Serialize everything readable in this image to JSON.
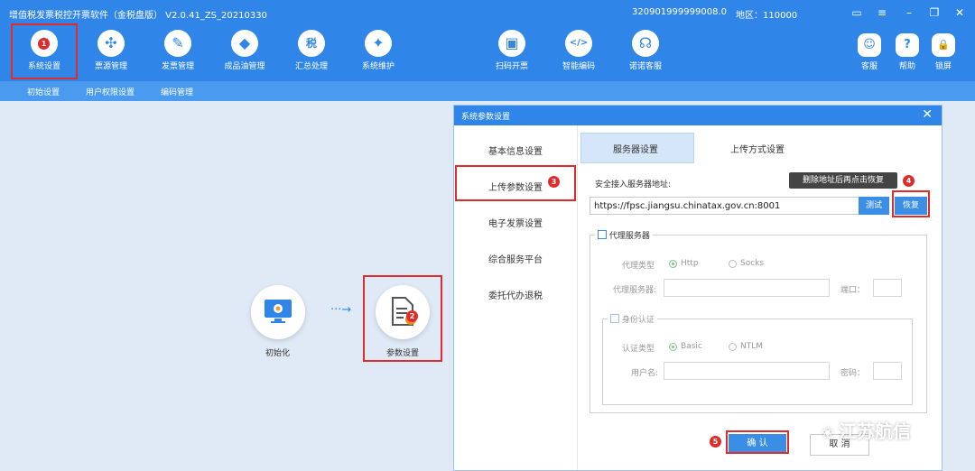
{
  "app": {
    "title": "增值税发票税控开票软件（金税盘版） V2.0.41_ZS_20210330",
    "tax_id": "320901999999008.0",
    "region": "地区：110000"
  },
  "toolbar": {
    "left": [
      {
        "label": "系统设置",
        "icon": "gear-icon",
        "glyph": "⚙"
      },
      {
        "label": "票源管理",
        "icon": "network-icon",
        "glyph": "✣"
      },
      {
        "label": "发票管理",
        "icon": "invoice-icon",
        "glyph": "✎"
      },
      {
        "label": "成品油管理",
        "icon": "oil-drum-icon",
        "glyph": "◆"
      },
      {
        "label": "汇总处理",
        "icon": "tax-summary-icon",
        "glyph": "税"
      },
      {
        "label": "系统维护",
        "icon": "wrench-icon",
        "glyph": "✦"
      }
    ],
    "middle": [
      {
        "label": "扫码开票",
        "icon": "scan-icon",
        "glyph": "▣"
      },
      {
        "label": "智能编码",
        "icon": "code-doc-icon",
        "glyph": "</>"
      },
      {
        "label": "诺诺客服",
        "icon": "headset-icon",
        "glyph": "☊"
      }
    ],
    "right": [
      {
        "label": "客服",
        "icon": "robot-icon",
        "glyph": "☺"
      },
      {
        "label": "帮助",
        "icon": "help-icon",
        "glyph": "?"
      },
      {
        "label": "锁屏",
        "icon": "lock-icon",
        "glyph": "🔒"
      }
    ]
  },
  "subnav": [
    "初始设置",
    "用户权限设置",
    "编码管理"
  ],
  "workflow": {
    "step1": "初始化",
    "arrow": "···→",
    "step2": "参数设置"
  },
  "dialog": {
    "title": "系统参数设置",
    "close": "✕",
    "side_items": [
      "基本信息设置",
      "上传参数设置",
      "电子发票设置",
      "综合服务平台",
      "委托代办退税"
    ],
    "tabs": [
      "服务器设置",
      "上传方式设置"
    ],
    "server_label": "安全接入服务器地址:",
    "server_url": "https://fpsc.jiangsu.chinatax.gov.cn:8001",
    "test_btn": "测试",
    "restore_btn": "恢复",
    "tooltip": "删除地址后再点击恢复",
    "proxy": {
      "title": "代理服务器",
      "type_label": "代理类型",
      "opt1": "Http",
      "opt2": "Socks",
      "server_label": "代理服务器:",
      "port_label": "端口："
    },
    "auth": {
      "title": "身份认证",
      "type_label": "认证类型",
      "opt1": "Basic",
      "opt2": "NTLM",
      "user_label": "用户名:",
      "pass_label": "密码："
    },
    "ok_btn": "确  认",
    "cancel_btn": "取  消"
  },
  "badges": [
    "1",
    "2",
    "3",
    "4",
    "5"
  ],
  "watermark": "江苏航信"
}
